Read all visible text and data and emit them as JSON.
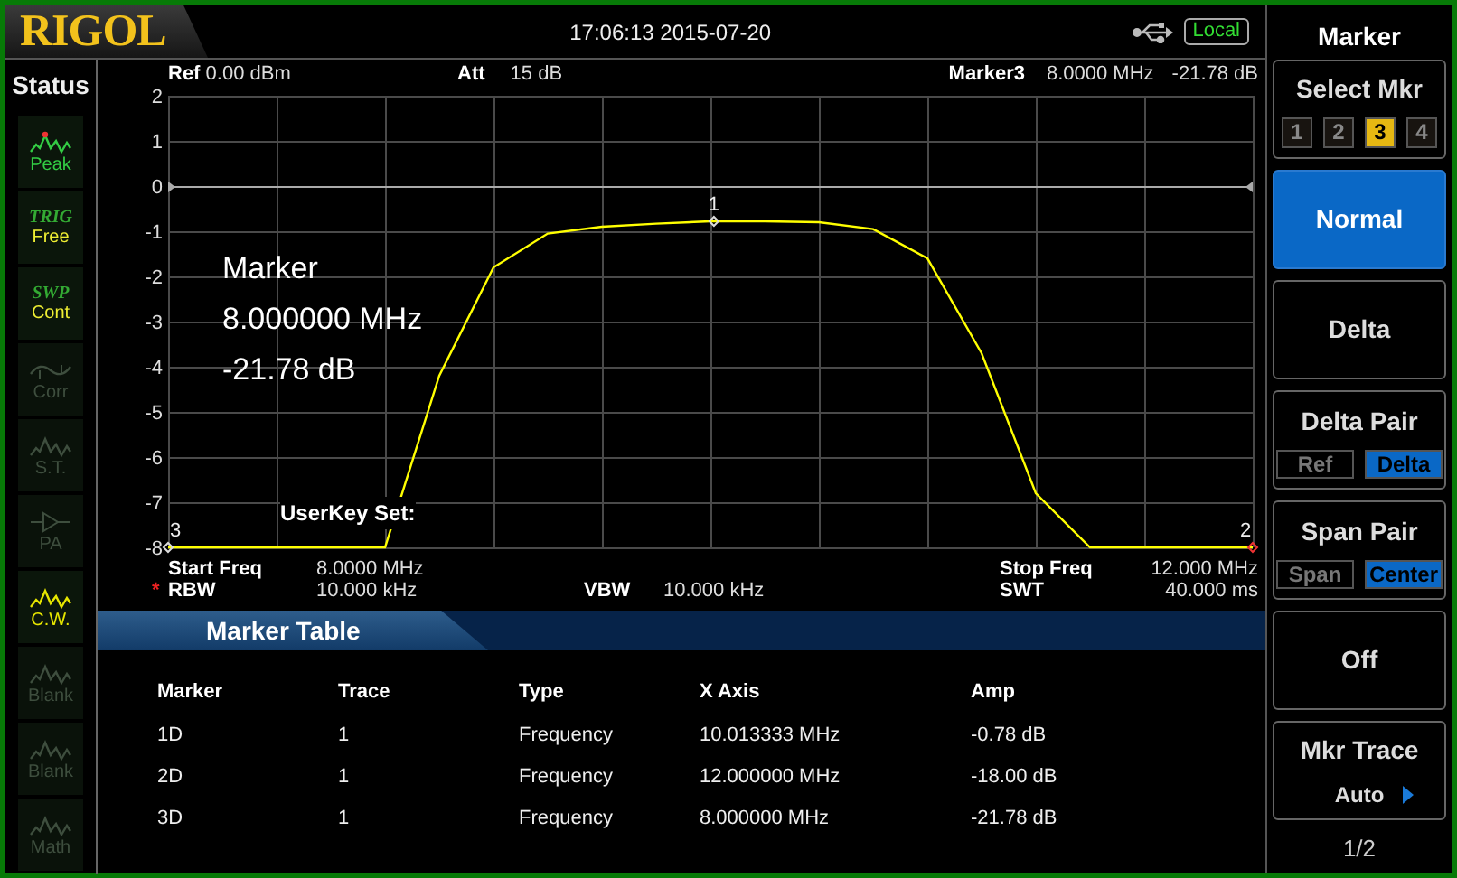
{
  "header": {
    "logo": "RIGOL",
    "datetime": "17:06:13 2015-07-20",
    "remote_status": "Local"
  },
  "status_panel": {
    "title": "Status",
    "items": [
      {
        "kind": "wave",
        "label": "Peak",
        "active": true,
        "color": "#33cc44"
      },
      {
        "kind": "text",
        "title": "TRIG",
        "label": "Free",
        "active": true
      },
      {
        "kind": "text",
        "title": "SWP",
        "label": "Cont",
        "active": true
      },
      {
        "kind": "corr",
        "label": "Corr",
        "active": false
      },
      {
        "kind": "wave",
        "label": "S.T.",
        "active": false
      },
      {
        "kind": "amp",
        "label": "PA",
        "active": false
      },
      {
        "kind": "wave",
        "label": "C.W.",
        "active": true,
        "color": "#e6e600"
      },
      {
        "kind": "wave",
        "label": "Blank",
        "active": false
      },
      {
        "kind": "wave",
        "label": "Blank",
        "active": false
      },
      {
        "kind": "wave",
        "label": "Math",
        "active": false
      }
    ]
  },
  "plot": {
    "ref_label": "Ref",
    "ref_value": "0.00 dBm",
    "att_label": "Att",
    "att_value": "15 dB",
    "marker_label": "Marker3",
    "marker_freq": "8.0000 MHz",
    "marker_amp": "-21.78 dB",
    "readout": [
      "Marker",
      "8.000000 MHz",
      "-21.78 dB"
    ],
    "userkey": "UserKey Set:",
    "chart_data": {
      "type": "line",
      "grid": true,
      "ref_lines": [
        {
          "axis": "y",
          "value": 0
        }
      ],
      "ylim": [
        -8,
        2
      ],
      "yticks": [
        2,
        1,
        0,
        -1,
        -2,
        -3,
        -4,
        -5,
        -6,
        -7,
        -8
      ],
      "categories": [
        null,
        null,
        null,
        null,
        null,
        null,
        null,
        null,
        null,
        null,
        null,
        null,
        null,
        null,
        null,
        null,
        null,
        null,
        null,
        null,
        null
      ],
      "series": [
        {
          "color": "#ffff00",
          "values": [
            -8,
            -8,
            -8,
            -8,
            -8,
            -4.2,
            -1.8,
            -1.05,
            -0.9,
            -0.83,
            -0.78,
            -0.78,
            -0.8,
            -0.95,
            -1.6,
            -3.7,
            -6.8,
            -8,
            -8,
            -8,
            -8
          ]
        }
      ]
    },
    "trace_markers": [
      "1",
      "2",
      "3"
    ],
    "start_label": "Start Freq",
    "start_value": "8.0000 MHz",
    "stop_label": "Stop Freq",
    "stop_value": "12.000 MHz",
    "rbw_flag": "*",
    "rbw_label": "RBW",
    "rbw_value": "10.000 kHz",
    "vbw_label": "VBW",
    "vbw_value": "10.000 kHz",
    "swt_label": "SWT",
    "swt_value": "40.000 ms"
  },
  "marker_table": {
    "title": "Marker Table",
    "columns": [
      "Marker",
      "Trace",
      "Type",
      "X Axis",
      "Amp"
    ],
    "rows": [
      [
        "1D",
        "1",
        "Frequency",
        "10.013333 MHz",
        "-0.78 dB"
      ],
      [
        "2D",
        "1",
        "Frequency",
        "12.000000 MHz",
        "-18.00 dB"
      ],
      [
        "3D",
        "1",
        "Frequency",
        "8.000000 MHz",
        "-21.78 dB"
      ]
    ]
  },
  "menu": {
    "title": "Marker",
    "keys": [
      {
        "kind": "digits",
        "label": "Select Mkr",
        "selected": false,
        "options": [
          {
            "label": "1",
            "selected": false
          },
          {
            "label": "2",
            "selected": false
          },
          {
            "label": "3",
            "selected": true
          },
          {
            "label": "4",
            "selected": false
          }
        ]
      },
      {
        "kind": "plain",
        "label": "Normal",
        "selected": true
      },
      {
        "kind": "plain",
        "label": "Delta",
        "selected": false
      },
      {
        "kind": "pair",
        "label": "Delta Pair",
        "selected": false,
        "options": [
          {
            "label": "Ref",
            "selected": false
          },
          {
            "label": "Delta",
            "selected": true
          }
        ]
      },
      {
        "kind": "pair",
        "label": "Span Pair",
        "selected": false,
        "options": [
          {
            "label": "Span",
            "selected": false
          },
          {
            "label": "Center",
            "selected": true
          }
        ]
      },
      {
        "kind": "plain",
        "label": "Off",
        "selected": false
      },
      {
        "kind": "value",
        "label": "Mkr Trace",
        "value": "Auto",
        "selected": false
      }
    ],
    "page": "1/2"
  }
}
